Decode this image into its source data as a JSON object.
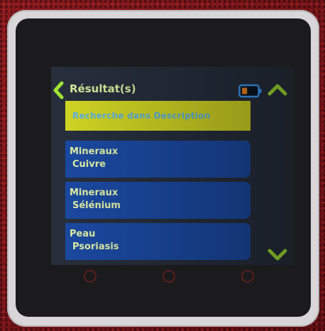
{
  "header": {
    "title": "Résultat(s)"
  },
  "search_banner": {
    "label": "Recherche dans Description"
  },
  "results": [
    {
      "category": "Mineraux",
      "item": "Cuivre"
    },
    {
      "category": "Mineraux",
      "item": "Sélénium"
    },
    {
      "category": "Peau",
      "item": "Psoriasis"
    }
  ],
  "colors": {
    "accent_green": "#a3e635",
    "title_text": "#d8ee9e",
    "banner_bg": "#d3d723",
    "banner_text": "#5fb4e6",
    "card_bg": "#1b4aa3",
    "card_text": "#e3f2a8",
    "battery_outline": "#3da0ff",
    "battery_fill": "#f08a24"
  },
  "icons": {
    "back": "chevron-left-icon",
    "battery": "battery-icon",
    "scroll_up": "chevron-up-icon",
    "scroll_down": "chevron-down-icon"
  },
  "battery": {
    "level": 0.35
  }
}
